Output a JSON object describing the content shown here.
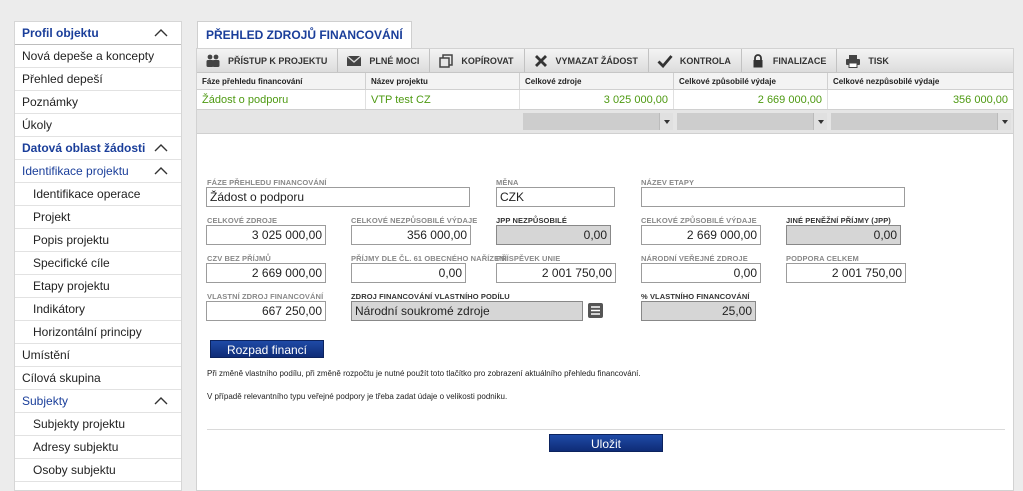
{
  "sidebar": {
    "items": [
      {
        "label": "Profil objektu"
      },
      {
        "label": "Nová depeše a koncepty"
      },
      {
        "label": "Přehled depeší"
      },
      {
        "label": "Poznámky"
      },
      {
        "label": "Úkoly"
      },
      {
        "label": "Datová oblast žádosti"
      },
      {
        "label": "Identifikace projektu"
      },
      {
        "label": "Identifikace operace"
      },
      {
        "label": "Projekt"
      },
      {
        "label": "Popis projektu"
      },
      {
        "label": "Specifické cíle"
      },
      {
        "label": "Etapy projektu"
      },
      {
        "label": "Indikátory"
      },
      {
        "label": "Horizontální principy"
      },
      {
        "label": "Umístění"
      },
      {
        "label": "Cílová skupina"
      },
      {
        "label": "Subjekty"
      },
      {
        "label": "Subjekty projektu"
      },
      {
        "label": "Adresy subjektu"
      },
      {
        "label": "Osoby subjektu"
      }
    ]
  },
  "tab": {
    "label": "PŘEHLED ZDROJŮ FINANCOVÁNÍ"
  },
  "toolbar": {
    "access_label": "PŘÍSTUP K PROJEKTU",
    "poa_label": "PLNÉ MOCI",
    "copy_label": "KOPÍROVAT",
    "delete_label": "VYMAZAT ŽÁDOST",
    "check_label": "KONTROLA",
    "finalize_label": "FINALIZACE",
    "print_label": "TISK"
  },
  "grid": {
    "columns": [
      "Fáze přehledu financování",
      "Název projektu",
      "Celkové zdroje",
      "Celkové způsobilé výdaje",
      "Celkové nezpůsobilé výdaje"
    ],
    "row": [
      "Žádost o podporu",
      "VTP test CZ",
      "3 025 000,00",
      "2 669 000,00",
      "356 000,00"
    ]
  },
  "form": {
    "faze_label": "FÁZE PŘEHLEDU FINANCOVÁNÍ",
    "faze_value": "Žádost o podporu",
    "mena_label": "MĚNA",
    "mena_value": "CZK",
    "etapa_label": "NÁZEV ETAPY",
    "etapa_value": "",
    "celkove_zdroje_label": "CELKOVÉ ZDROJE",
    "celkove_zdroje_value": "3 025 000,00",
    "nezpusobile_label": "CELKOVÉ NEZPŮSOBILÉ VÝDAJE",
    "nezpusobile_value": "356 000,00",
    "jpp_nezpusobile_label": "JPP NEZPŮSOBILÉ",
    "jpp_nezpusobile_value": "0,00",
    "zpusobile_label": "CELKOVÉ ZPŮSOBILÉ VÝDAJE",
    "zpusobile_value": "2 669 000,00",
    "jpp_label": "JINÉ PENĚŽNÍ PŘÍJMY (JPP)",
    "jpp_value": "0,00",
    "czv_label": "CZV BEZ PŘÍJMŮ",
    "czv_value": "2 669 000,00",
    "prijmy61_label": "PŘÍJMY DLE ČL. 61 OBECNÉHO NAŘÍZENÍ",
    "prijmy61_value": "0,00",
    "prispevek_label": "PŘÍSPĚVEK UNIE",
    "prispevek_value": "2 001 750,00",
    "narodni_label": "NÁRODNÍ VEŘEJNÉ ZDROJE",
    "narodni_value": "0,00",
    "podpora_label": "PODPORA CELKEM",
    "podpora_value": "2 001 750,00",
    "vlastni_label": "VLASTNÍ ZDROJ FINANCOVÁNÍ",
    "vlastni_value": "667 250,00",
    "zdroj_label": "ZDROJ FINANCOVÁNÍ VLASTNÍHO PODÍLU",
    "zdroj_value": "Národní soukromé zdroje",
    "procento_label": "% VLASTNÍHO FINANCOVÁNÍ",
    "procento_value": "25,00"
  },
  "buttons": {
    "rozpad": "Rozpad financí",
    "ulozit": "Uložit"
  },
  "notes": {
    "note1": "Při změně vlastního podílu, při změně rozpočtu je nutné použít toto tlačítko pro zobrazení aktuálního přehledu financování.",
    "note2": "V případě relevantního typu veřejné podpory je třeba zadat údaje o velikosti podniku."
  },
  "colors": {
    "accent": "#1a3e9a",
    "green_text": "#4e9a12",
    "button_blue": "#173c8e"
  }
}
